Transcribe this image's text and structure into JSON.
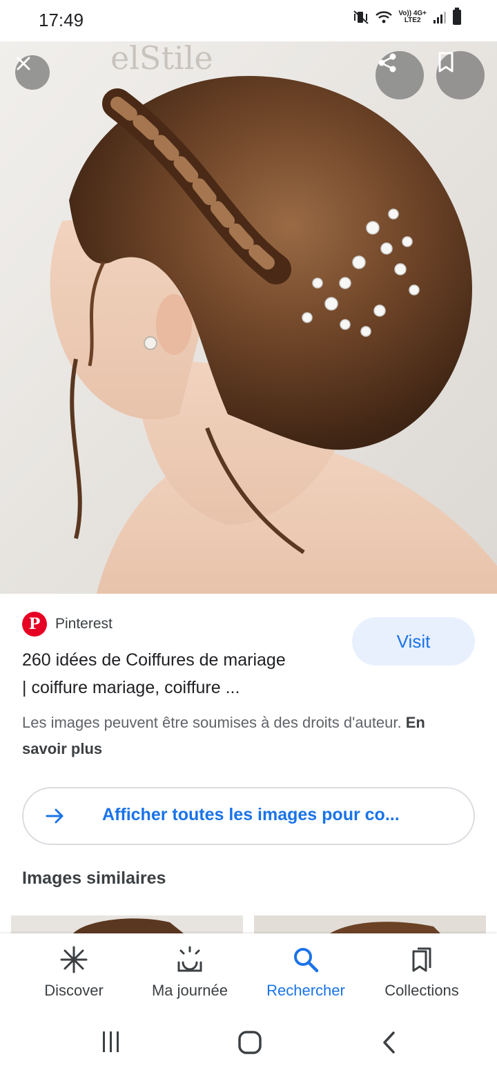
{
  "status_bar": {
    "time": "17:49",
    "network_top": "Vo)) 4G+",
    "network_bottom": "LTE2",
    "icons": [
      "mute-vibrate-icon",
      "wifi-icon",
      "signal-icon",
      "battery-icon"
    ]
  },
  "hero": {
    "buttons": [
      "close-icon",
      "share-icon",
      "bookmark-icon"
    ]
  },
  "result": {
    "source": "Pinterest",
    "title_line1": "260 idées de Coiffures de mariage",
    "title_line2": "| coiffure mariage, coiffure ...",
    "visit_label": "Visit",
    "copyright_text": "Les images peuvent être soumises à des droits d'auteur.",
    "learn_more": "En savoir plus",
    "all_images_label": "Afficher toutes les images pour co...",
    "similar_title": "Images similaires"
  },
  "bottom_nav": {
    "items": [
      {
        "label": "Discover",
        "icon": "asterisk-icon",
        "active": false
      },
      {
        "label": "Ma journée",
        "icon": "sunrise-icon",
        "active": false
      },
      {
        "label": "Rechercher",
        "icon": "search-icon",
        "active": true
      },
      {
        "label": "Collections",
        "icon": "collections-icon",
        "active": false
      }
    ]
  },
  "colors": {
    "accent": "#1a73e8",
    "visit_bg": "#e8f0fe",
    "pinterest": "#e60023",
    "text": "#202124",
    "secondary": "#5f6368"
  }
}
